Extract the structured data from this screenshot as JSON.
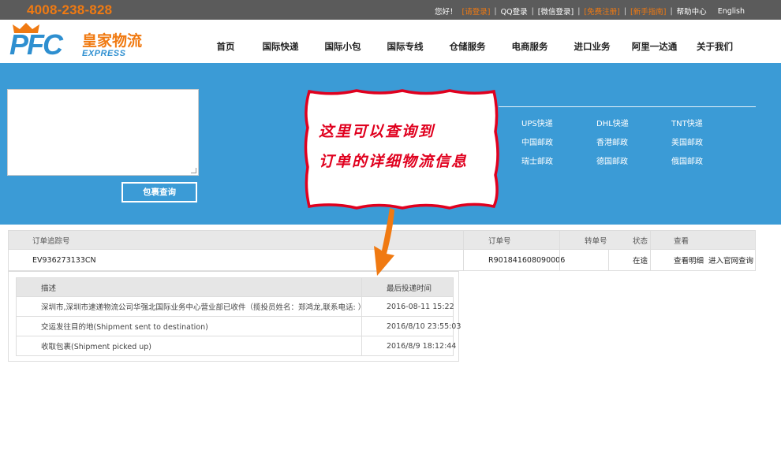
{
  "topbar": {
    "phone": "4008-238-828",
    "greeting": "您好！",
    "login": "[请登录]",
    "qq_login": "QQ登录",
    "wechat_login": "[微信登录]",
    "register": "[免费注册]",
    "newbie": "[新手指南]",
    "help": "帮助中心",
    "english": "English"
  },
  "logo": {
    "mark": "PFC",
    "name_cn": "皇家物流",
    "name_en": "EXPRESS"
  },
  "nav": {
    "items": [
      "首页",
      "国际快递",
      "国际小包",
      "国际专线",
      "仓储服务",
      "电商服务",
      "进口业务",
      "阿里一达通",
      "关于我们"
    ]
  },
  "tracking": {
    "input_value": "",
    "button_label": "包裹查询"
  },
  "carriers": [
    "UPS快递",
    "DHL快递",
    "TNT快递",
    "中国邮政",
    "香港邮政",
    "美国邮政",
    "瑞士邮政",
    "德国邮政",
    "俄国邮政"
  ],
  "callout": {
    "line1": "这里可以查询到",
    "line2": "订单的详细物流信息"
  },
  "results": {
    "headers": {
      "tracking_no": "订单追踪号",
      "order_no": "订单号",
      "transfer_no": "转单号",
      "status": "状态",
      "view": "查看"
    },
    "row": {
      "tracking_no": "EV936273133CN",
      "order_no": "R901841608090006",
      "transfer_no": "",
      "status": "在途",
      "view_detail": "查看明细",
      "official_site": "进入官网查询"
    }
  },
  "details": {
    "headers": {
      "description": "描述",
      "time": "最后投递时间"
    },
    "rows": [
      {
        "description": "深圳市,深圳市速递物流公司华强北国际业务中心营业部已收件（揽投员姓名：郑鸿龙,联系电话: ）",
        "time": "2016-08-11 15:22"
      },
      {
        "description": "交运发往目的地(Shipment sent to destination)",
        "time": "2016/8/10 23:55:03"
      },
      {
        "description": "收取包裹(Shipment picked up)",
        "time": "2016/8/9 18:12:44"
      }
    ]
  },
  "colors": {
    "accent_orange": "#f07a12",
    "band_blue": "#3b9bd6",
    "callout_red": "#e0001e"
  }
}
